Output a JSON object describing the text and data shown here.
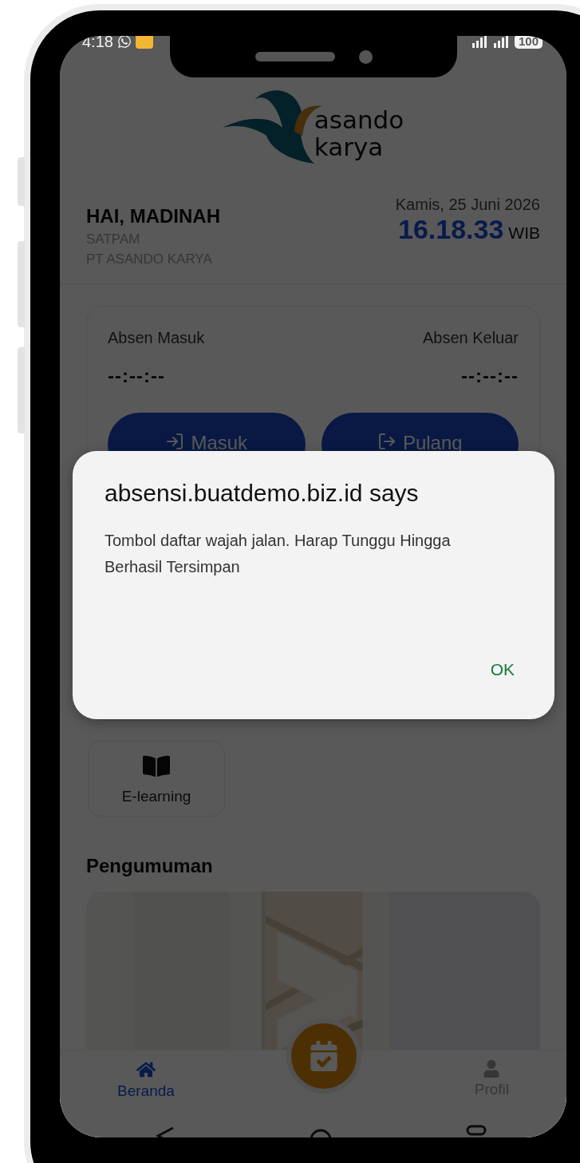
{
  "status_bar": {
    "time": "4:18",
    "battery": "100"
  },
  "brand": {
    "line_1": "asando",
    "line_2": "karya"
  },
  "greeting": {
    "title": "HAI, MADINAH",
    "role": "SATPAM",
    "company": "PT ASANDO KARYA"
  },
  "clock": {
    "date": "Kamis, 25 Juni 2026",
    "time": "16.18.33",
    "zone": "WIB"
  },
  "attendance": {
    "columns": [
      {
        "label": "Absen Masuk",
        "time": "--:--:--"
      },
      {
        "label": "Absen Keluar",
        "time": "--:--:--"
      }
    ],
    "buttons": [
      {
        "label": "Masuk",
        "kind": "in"
      },
      {
        "label": "Pulang",
        "kind": "out"
      }
    ]
  },
  "menu": [
    {
      "label": "E-learning",
      "kind": "book"
    }
  ],
  "announcements": {
    "title": "Pengumuman"
  },
  "bottom_nav": [
    {
      "label": "Beranda",
      "kind": "home",
      "selected": true
    },
    {
      "label": "Profil",
      "kind": "profile",
      "selected": false
    }
  ],
  "dialog": {
    "title": "absensi.buatdemo.biz.id says",
    "message": "Tombol daftar wajah jalan. Harap Tunggu Hingga Berhasil Tersimpan",
    "buttons": [
      "OK"
    ]
  }
}
